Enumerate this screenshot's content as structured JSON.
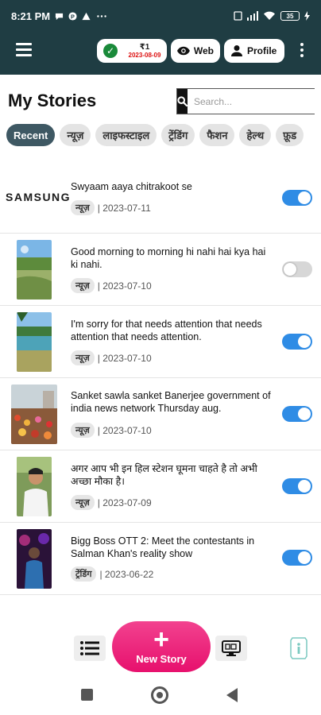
{
  "status_bar": {
    "time": "8:21 PM",
    "battery": "35",
    "icons": [
      "chat-icon",
      "brand-icon",
      "alert-icon",
      "more-dots-icon",
      "sim-icon",
      "signal-icon",
      "wifi-icon",
      "battery-icon",
      "charging-icon"
    ]
  },
  "header": {
    "wallet_amount": "₹1",
    "wallet_date": "2023-08-09",
    "web_label": "Web",
    "profile_label": "Profile",
    "colors": {
      "background": "#1f3d43",
      "wallet_ok": "#1a8a3a",
      "date": "#dd1111"
    }
  },
  "page": {
    "title": "My Stories",
    "search_placeholder": "Search..."
  },
  "tabs": [
    {
      "label": "Recent",
      "active": true
    },
    {
      "label": "न्यूज़"
    },
    {
      "label": "लाइफस्टाइल"
    },
    {
      "label": "ट्रेंडिंग"
    },
    {
      "label": "फैशन"
    },
    {
      "label": "हेल्थ"
    },
    {
      "label": "फ़ूड"
    }
  ],
  "stories": [
    {
      "thumb": "samsung-logo",
      "brand_text": "SAMSUNG",
      "title": "Swyaam aaya chitrakoot se",
      "category": "न्यूज़",
      "date": "| 2023-07-11",
      "published": true
    },
    {
      "thumb": "landscape-photo",
      "title": "Good morning to morning hi nahi hai kya hai ki nahi.",
      "category": "न्यूज़",
      "date": "| 2023-07-10",
      "published": false
    },
    {
      "thumb": "landscape-photo",
      "title": "I'm sorry for that needs attention that needs attention that needs attention.",
      "category": "न्यूज़",
      "date": "| 2023-07-10",
      "published": true
    },
    {
      "thumb": "crowd-photo",
      "title": "Sanket sawla sanket Banerjee government of india news network Thursday aug.",
      "category": "न्यूज़",
      "date": "| 2023-07-10",
      "published": true
    },
    {
      "thumb": "person-photo",
      "title": "अगर आप भी इन हिल स्टेशन घूमना चाहते है तो अभी अच्छा मौका है।",
      "category": "न्यूज़",
      "date": "| 2023-07-09",
      "published": true
    },
    {
      "thumb": "poster-photo",
      "title": "Bigg Boss OTT 2: Meet the contestants in Salman Khan's reality show",
      "category": "ट्रेंडिंग",
      "date": "| 2023-06-22",
      "published": true
    }
  ],
  "bottom_bar": {
    "new_story_label": "New Story",
    "colors": {
      "fab": "#e91e73",
      "toggle_on": "#2f8ce5",
      "tab_active": "#3e5863"
    }
  }
}
